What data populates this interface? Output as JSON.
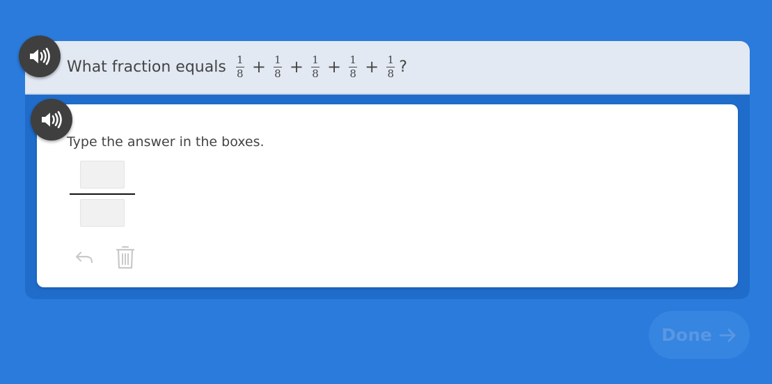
{
  "question": {
    "prefix": "What fraction equals",
    "terms": [
      {
        "numerator": "1",
        "denominator": "8"
      },
      {
        "numerator": "1",
        "denominator": "8"
      },
      {
        "numerator": "1",
        "denominator": "8"
      },
      {
        "numerator": "1",
        "denominator": "8"
      },
      {
        "numerator": "1",
        "denominator": "8"
      }
    ],
    "operator": "+",
    "suffix": "?"
  },
  "answer": {
    "instruction": "Type the answer in the boxes.",
    "numerator_value": "",
    "denominator_value": ""
  },
  "toolbar": {
    "undo_icon": "undo-icon",
    "delete_icon": "trash-icon"
  },
  "audio": {
    "icon": "speaker-icon"
  },
  "done_button": {
    "label": "Done",
    "icon": "arrow-right-icon"
  },
  "colors": {
    "background": "#2a7bdc",
    "header": "#e2e9f3",
    "panel": "#ffffff",
    "speaker": "#3f3f3f",
    "done_disabled": "#3585e1"
  }
}
